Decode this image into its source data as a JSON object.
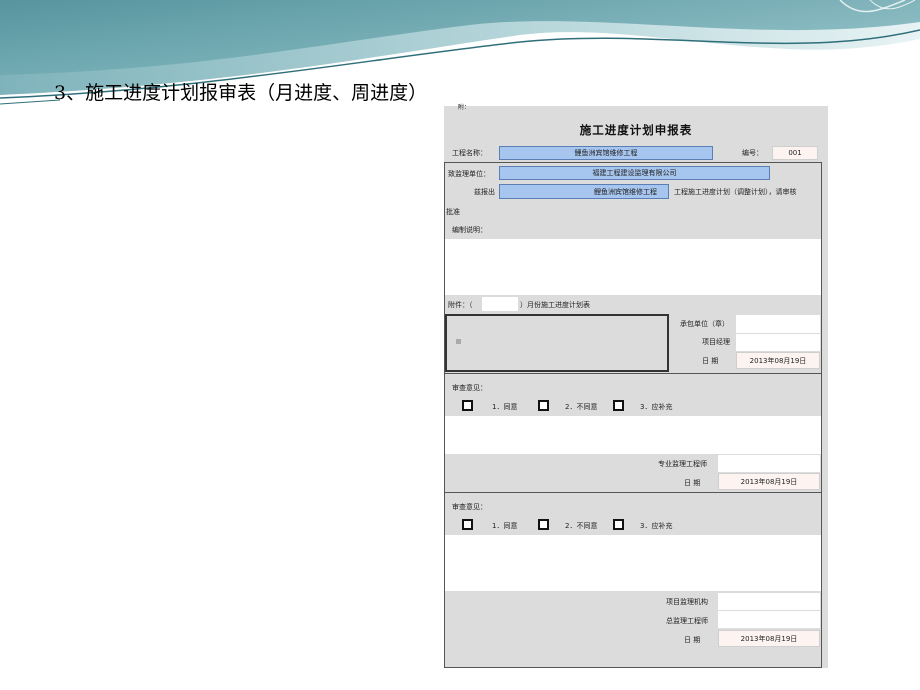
{
  "slide": {
    "title": "3、施工进度计划报审表（月进度、周进度）"
  },
  "form": {
    "corner_mark": "附：",
    "title": "施工进度计划申报表",
    "project_name_label": "工程名称：",
    "project_name_value": "鲤鱼洲宾馆维修工程",
    "serial_label": "编号：",
    "serial_value": "001",
    "to_label": "致监理单位：",
    "to_value": "福建工程建设监理有限公司",
    "submit_label": "兹报出",
    "submit_value": "鲤鱼洲宾馆维修工程",
    "submit_suffix": "工程施工进度计划（调整计划），请审核",
    "approve_label": "批准",
    "explain_label": "编制说明：",
    "attach_prefix": "附件：（",
    "attach_suffix": "）月份施工进度计划表",
    "contractor_label": "承包单位（章）",
    "pm_label": "项目经理",
    "date_label": "日      期",
    "date1": "2013年08月19日",
    "review1": {
      "label": "审查意见：",
      "options": [
        "1．同意",
        "2．不同意",
        "3．应补充"
      ],
      "signer_label": "专业监理工程师",
      "date_label": "日      期",
      "date": "2013年08月19日"
    },
    "review2": {
      "label": "审查意见：",
      "options": [
        "1．同意",
        "2．不同意",
        "3．应补充"
      ],
      "org_label": "项目监理机构",
      "chief_label": "总监理工程师",
      "date_label": "日      期",
      "date": "2013年08月19日"
    }
  },
  "colors": {
    "header_teal": "#5f9ea8",
    "header_light": "#c9e2e6",
    "form_grey": "#dcdcdc",
    "cell_blue": "#a7c6ef"
  }
}
